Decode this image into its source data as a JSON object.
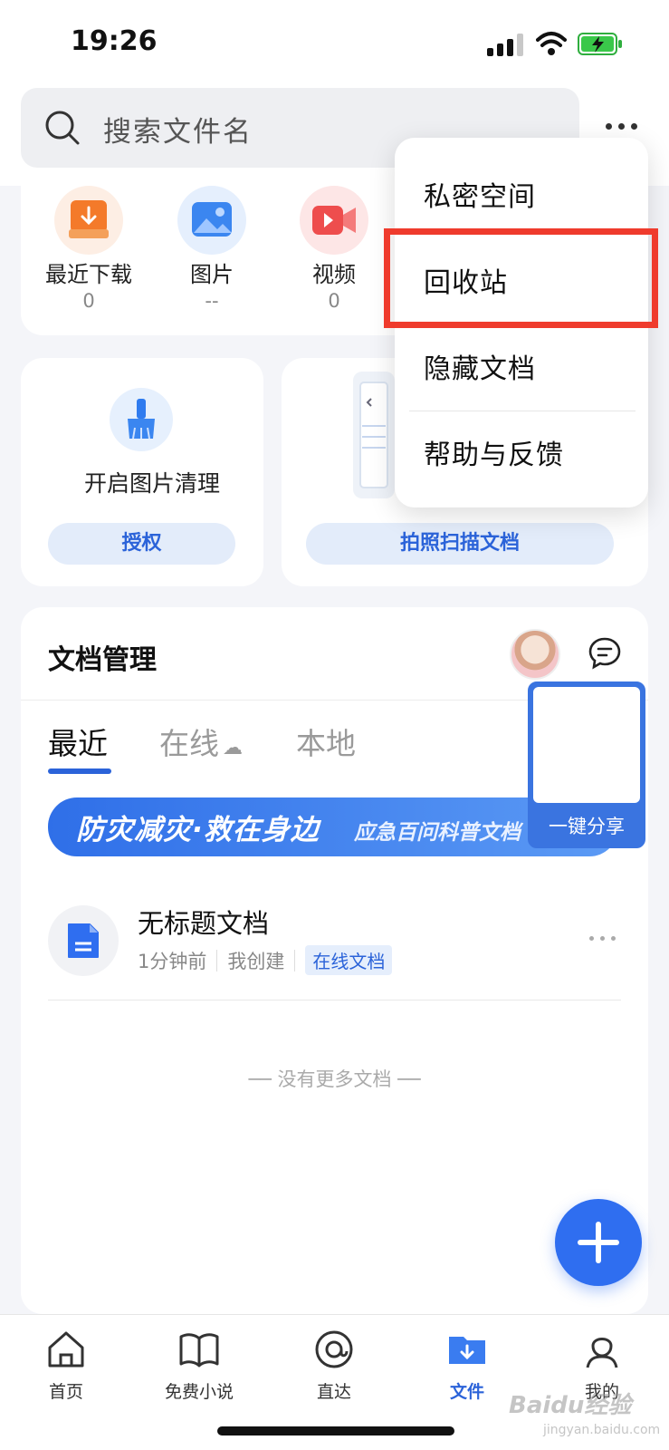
{
  "status_bar": {
    "time": "19:26"
  },
  "search": {
    "placeholder": "搜索文件名"
  },
  "categories": [
    {
      "label": "最近下载",
      "count": "0",
      "icon": "download-icon",
      "color": "#f47a2a"
    },
    {
      "label": "图片",
      "count": "--",
      "icon": "image-icon",
      "color": "#3b86f0"
    },
    {
      "label": "视频",
      "count": "0",
      "icon": "video-icon",
      "color": "#ee4d4d"
    }
  ],
  "features": {
    "clean_title": "开启图片清理",
    "clean_button": "授权",
    "scan_button": "拍照扫描文档"
  },
  "docs": {
    "title": "文档管理",
    "tabs": [
      "最近",
      "在线",
      "本地"
    ],
    "banner_main": "防灾减灾·救在身边",
    "banner_sub": "应急百问科普文档",
    "item": {
      "title": "无标题文档",
      "time": "1分钟前",
      "creator": "我创建",
      "tag": "在线文档"
    },
    "no_more": "没有更多文档"
  },
  "share": {
    "label": "一键分享"
  },
  "menu": {
    "items": [
      "私密空间",
      "回收站",
      "隐藏文档",
      "帮助与反馈"
    ],
    "highlighted_index": 1
  },
  "bottom_nav": {
    "items": [
      {
        "label": "首页",
        "icon": "home-icon"
      },
      {
        "label": "免费小说",
        "icon": "book-icon"
      },
      {
        "label": "直达",
        "icon": "at-icon"
      },
      {
        "label": "文件",
        "icon": "folder-download-icon",
        "active": true
      },
      {
        "label": "我的",
        "icon": "user-icon"
      }
    ]
  },
  "watermark": {
    "brand": "Baidu经验",
    "url": "jingyan.baidu.com"
  },
  "colors": {
    "accent": "#2b63d9",
    "highlight": "#ef3b2d"
  }
}
